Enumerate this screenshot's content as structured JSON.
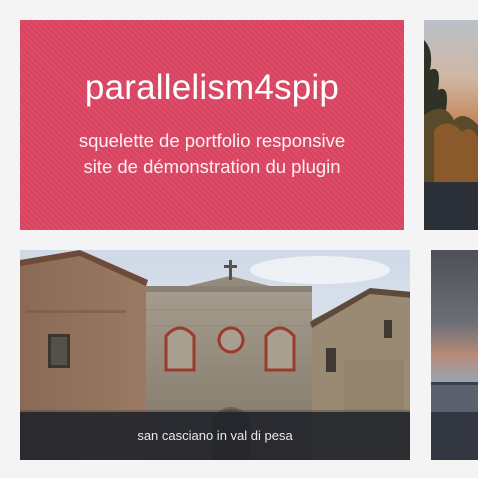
{
  "hero": {
    "title": "parallelism4spip",
    "subtitle_line1": "squelette de portfolio responsive",
    "subtitle_line2": "site de démonstration du plugin",
    "background_color": "#dc4663"
  },
  "tiles": [
    {
      "name": "sunset-trees-photo"
    },
    {
      "name": "church-photo",
      "caption": "san casciano in val di pesa"
    },
    {
      "name": "seascape-photo"
    }
  ]
}
